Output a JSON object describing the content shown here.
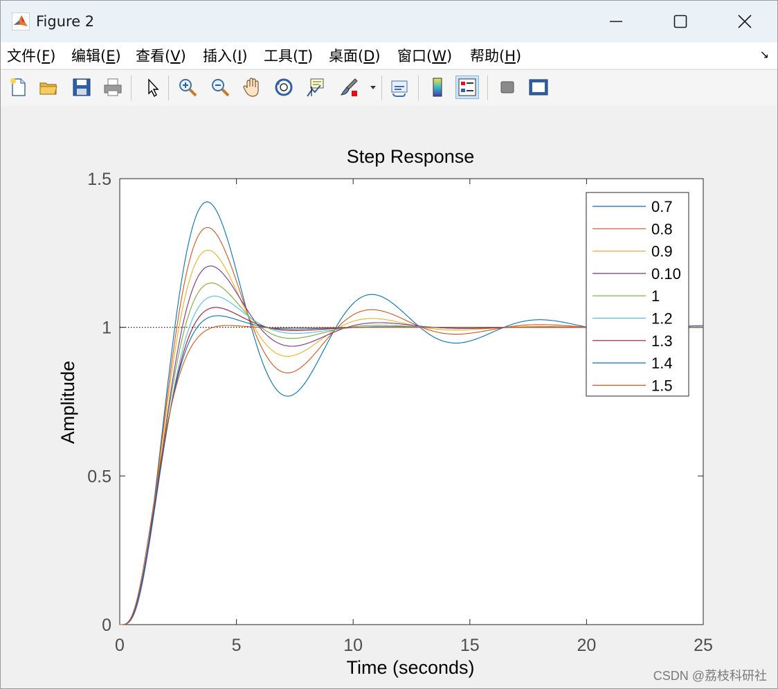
{
  "window": {
    "title": "Figure 2",
    "controls": {
      "minimize": "minimize",
      "maximize": "maximize",
      "close": "close"
    }
  },
  "menu": [
    {
      "label": "文件(",
      "key": "F",
      "tail": ")"
    },
    {
      "label": "编辑(",
      "key": "E",
      "tail": ")"
    },
    {
      "label": "查看(",
      "key": "V",
      "tail": ")"
    },
    {
      "label": "插入(",
      "key": "I",
      "tail": ")"
    },
    {
      "label": "工具(",
      "key": "T",
      "tail": ")"
    },
    {
      "label": "桌面(",
      "key": "D",
      "tail": ")"
    },
    {
      "label": "窗口(",
      "key": "W",
      "tail": ")"
    },
    {
      "label": "帮助(",
      "key": "H",
      "tail": ")"
    }
  ],
  "toolbar": [
    "new-figure-icon",
    "open-folder-icon",
    "save-icon",
    "print-icon",
    "select-arrow-icon",
    "zoom-in-icon",
    "zoom-out-icon",
    "pan-hand-icon",
    "rotate-3d-icon",
    "data-cursor-icon",
    "brush-icon",
    "link-plot-icon",
    "colorbar-icon",
    "legend-icon",
    "hide-plot-tools-icon",
    "show-plot-tools-icon"
  ],
  "watermark": "CSDN @荔枝科研社",
  "chart_data": {
    "type": "line",
    "title": "Step Response",
    "xlabel": "Time (seconds)",
    "ylabel": "Amplitude",
    "xlim": [
      0,
      25
    ],
    "ylim": [
      0,
      1.5
    ],
    "xticks": [
      "0",
      "5",
      "10",
      "15",
      "20",
      "25"
    ],
    "yticks": [
      "0",
      "0.5",
      "1",
      "1.5"
    ],
    "reference_line": 1,
    "legend_position": "top-right",
    "series": [
      {
        "name": "0.7",
        "color": "#0072BD",
        "peak_time": 3.6,
        "peak": 1.48
      },
      {
        "name": "0.8",
        "color": "#D95319",
        "peak_time": 3.6,
        "peak": 1.39
      },
      {
        "name": "0.9",
        "color": "#EDB120",
        "peak_time": 3.6,
        "peak": 1.31
      },
      {
        "name": "0.10",
        "color": "#7E2F8E",
        "peak_time": 3.7,
        "peak": 1.25
      },
      {
        "name": "1",
        "color": "#77AC30",
        "peak_time": 3.7,
        "peak": 1.19
      },
      {
        "name": "1.2",
        "color": "#4DBEEE",
        "peak_time": 3.8,
        "peak": 1.14
      },
      {
        "name": "1.3",
        "color": "#A2142F",
        "peak_time": 3.8,
        "peak": 1.1
      },
      {
        "name": "1.4",
        "color": "#0072BD",
        "peak_time": 3.8,
        "peak": 1.07
      },
      {
        "name": "1.5",
        "color": "#D95319",
        "peak_time": 3.9,
        "peak": 1.03
      }
    ]
  }
}
